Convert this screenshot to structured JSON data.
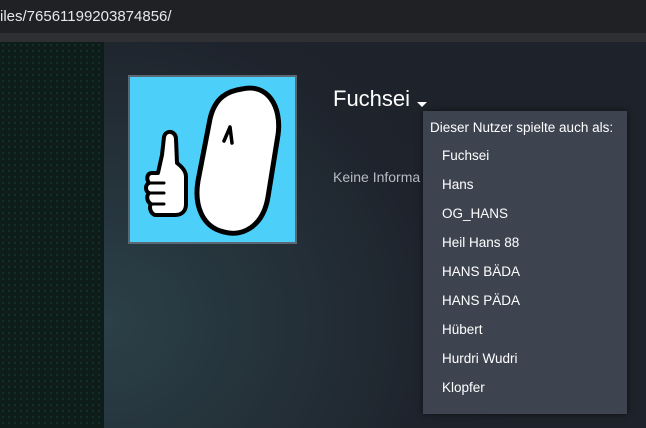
{
  "browser": {
    "url": "iles/76561199203874856/"
  },
  "profile": {
    "username": "Fuchsei",
    "info_text": "Keine Informa"
  },
  "alias_dropdown": {
    "header": "Dieser Nutzer spielte auch als:",
    "items": [
      {
        "label": "Fuchsei"
      },
      {
        "label": "Hans"
      },
      {
        "label": "OG_HANS"
      },
      {
        "label": "Heil Hans 88"
      },
      {
        "label": "HANS BÄDA"
      },
      {
        "label": "HANS PÄDA"
      },
      {
        "label": "Hübert"
      },
      {
        "label": "Hurdri Wudri"
      },
      {
        "label": "Klopfer"
      }
    ]
  },
  "colors": {
    "avatar_background": "#4ccff8",
    "dropdown_background": "#3d4450"
  }
}
